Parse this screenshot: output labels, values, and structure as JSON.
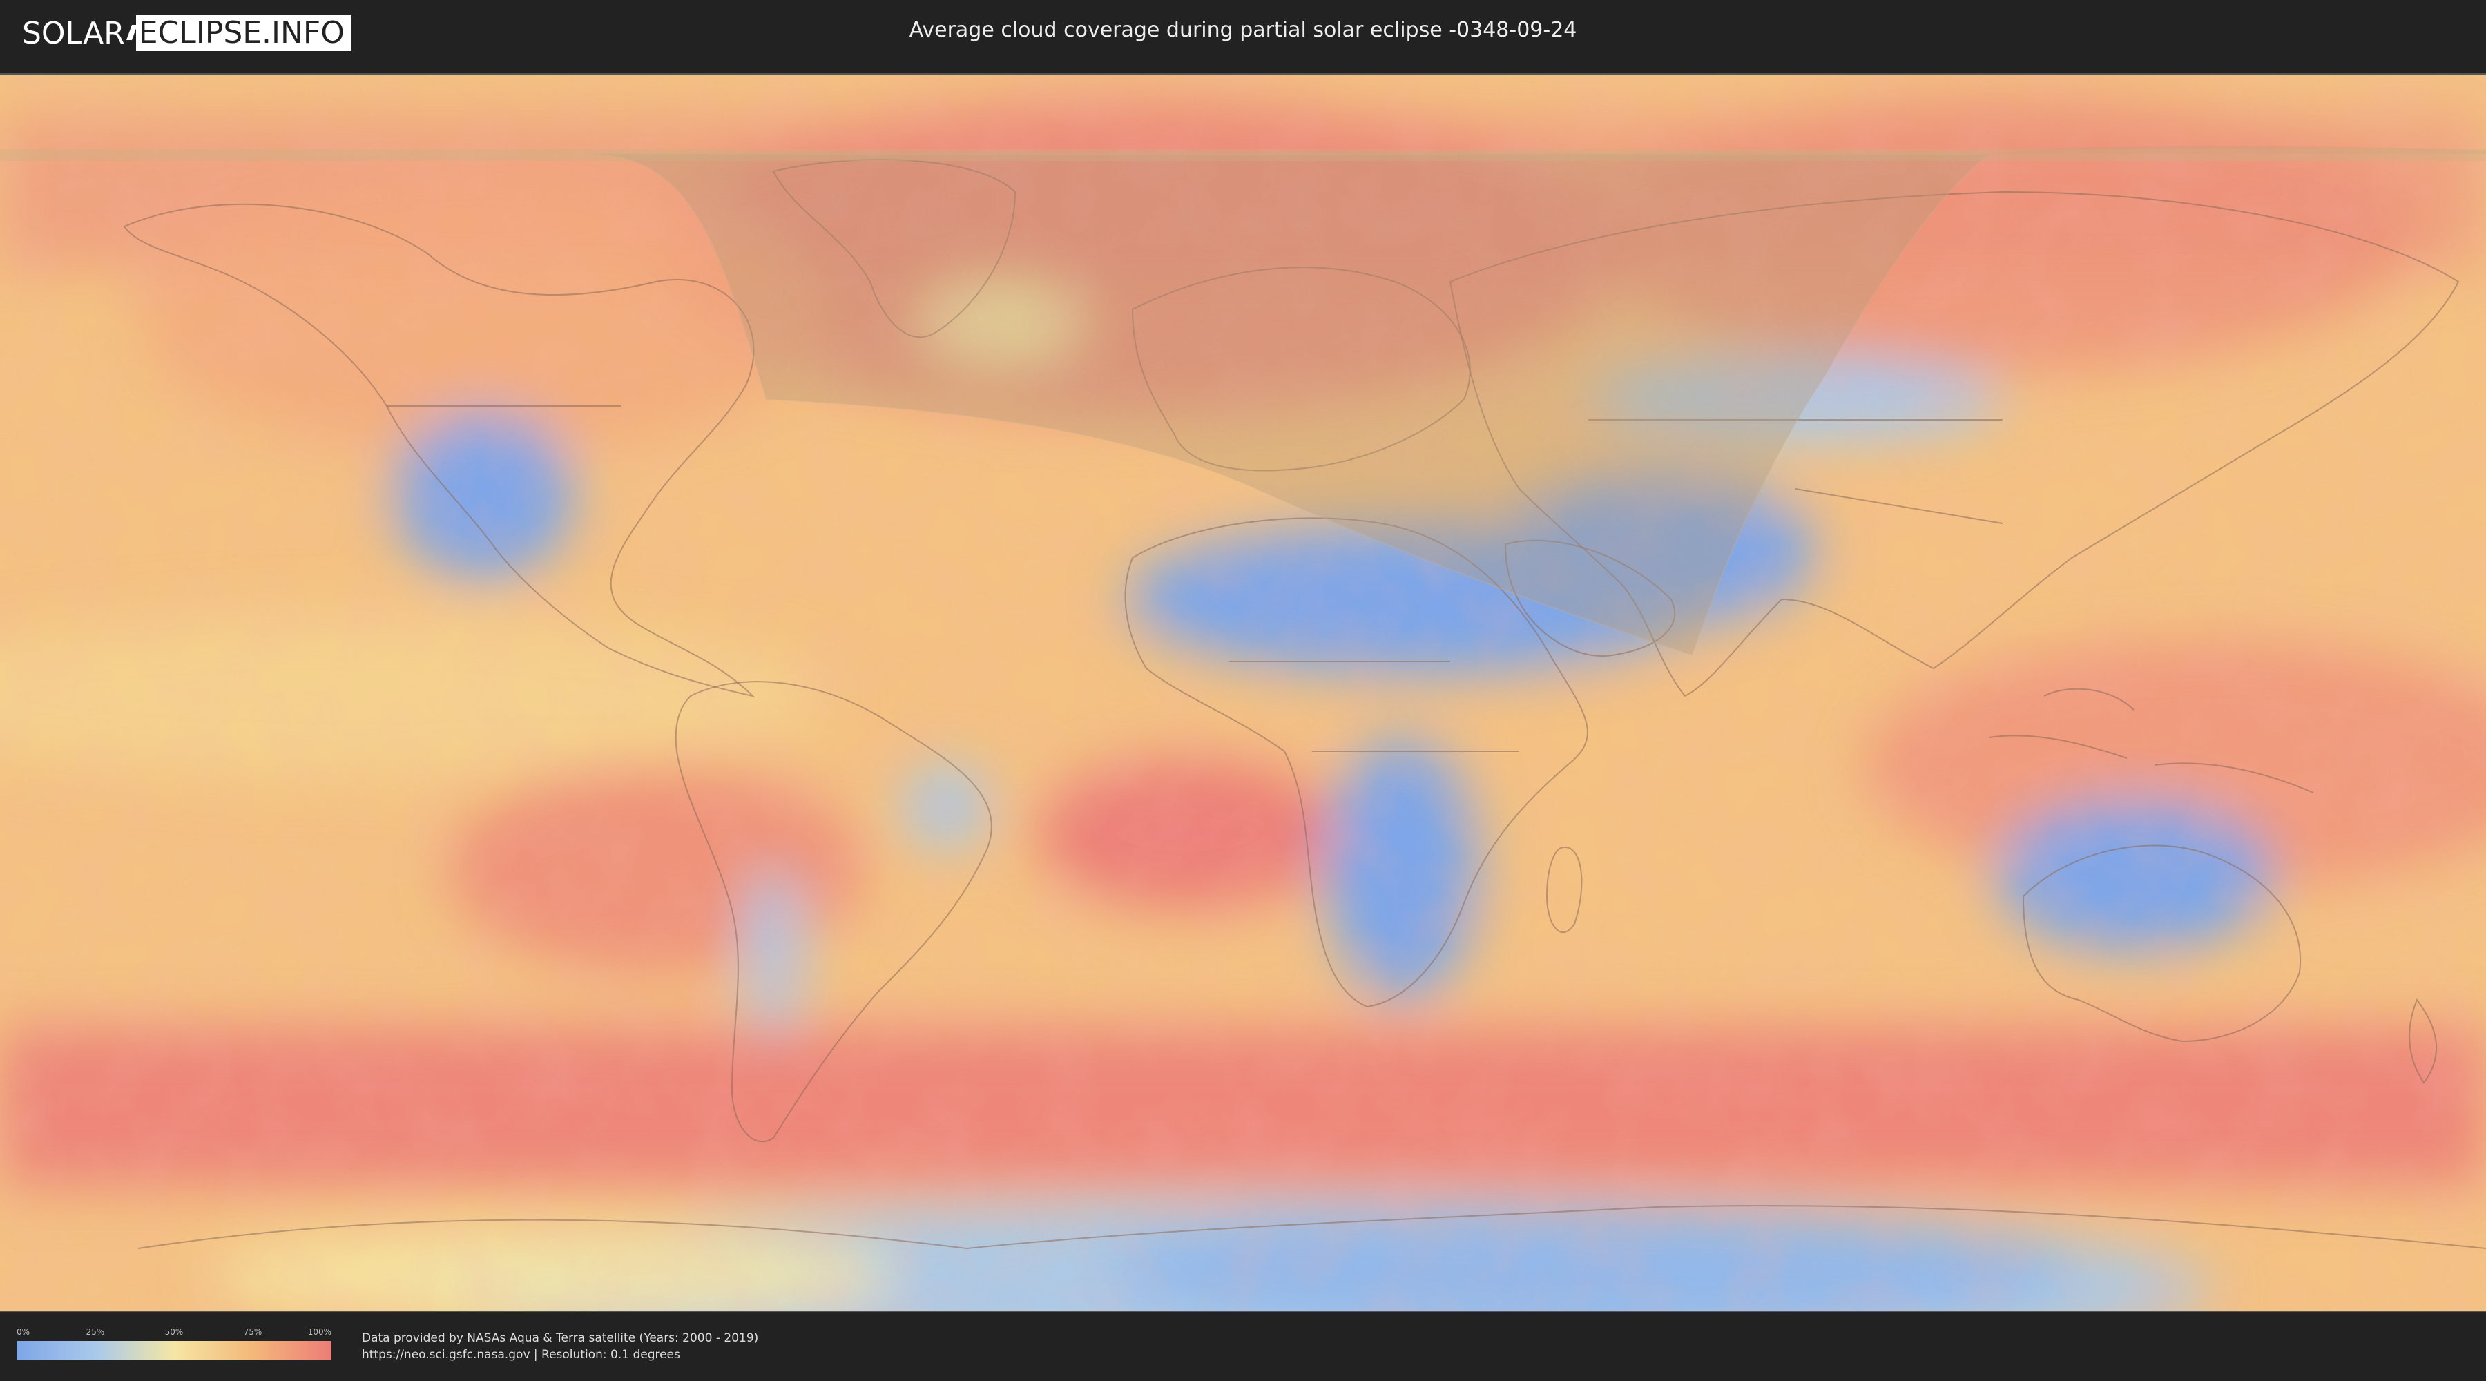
{
  "header": {
    "logo_left": "SOLAR",
    "logo_right": "ECLIPSE.INFO",
    "title": "Average cloud coverage during partial solar eclipse -0348-09-24"
  },
  "legend": {
    "ticks": [
      "0%",
      "25%",
      "50%",
      "75%",
      "100%"
    ],
    "colors": [
      "#7ea6e8",
      "#a9c9ea",
      "#f5e6a4",
      "#f4b87a",
      "#ec7d78"
    ]
  },
  "footer": {
    "credit_line1": "Data provided by NASAs Aqua & Terra satellite (Years: 2000 - 2019)",
    "credit_line2": "https://neo.sci.gsfc.nasa.gov | Resolution: 0.1 degrees"
  },
  "map": {
    "palette": {
      "clear": "#7ea6e8",
      "low": "#a9c9ea",
      "mid": "#f5e6a4",
      "high": "#f4b87a",
      "overcast": "#ec7d78",
      "shadow_overlay": "#b49a78"
    }
  }
}
